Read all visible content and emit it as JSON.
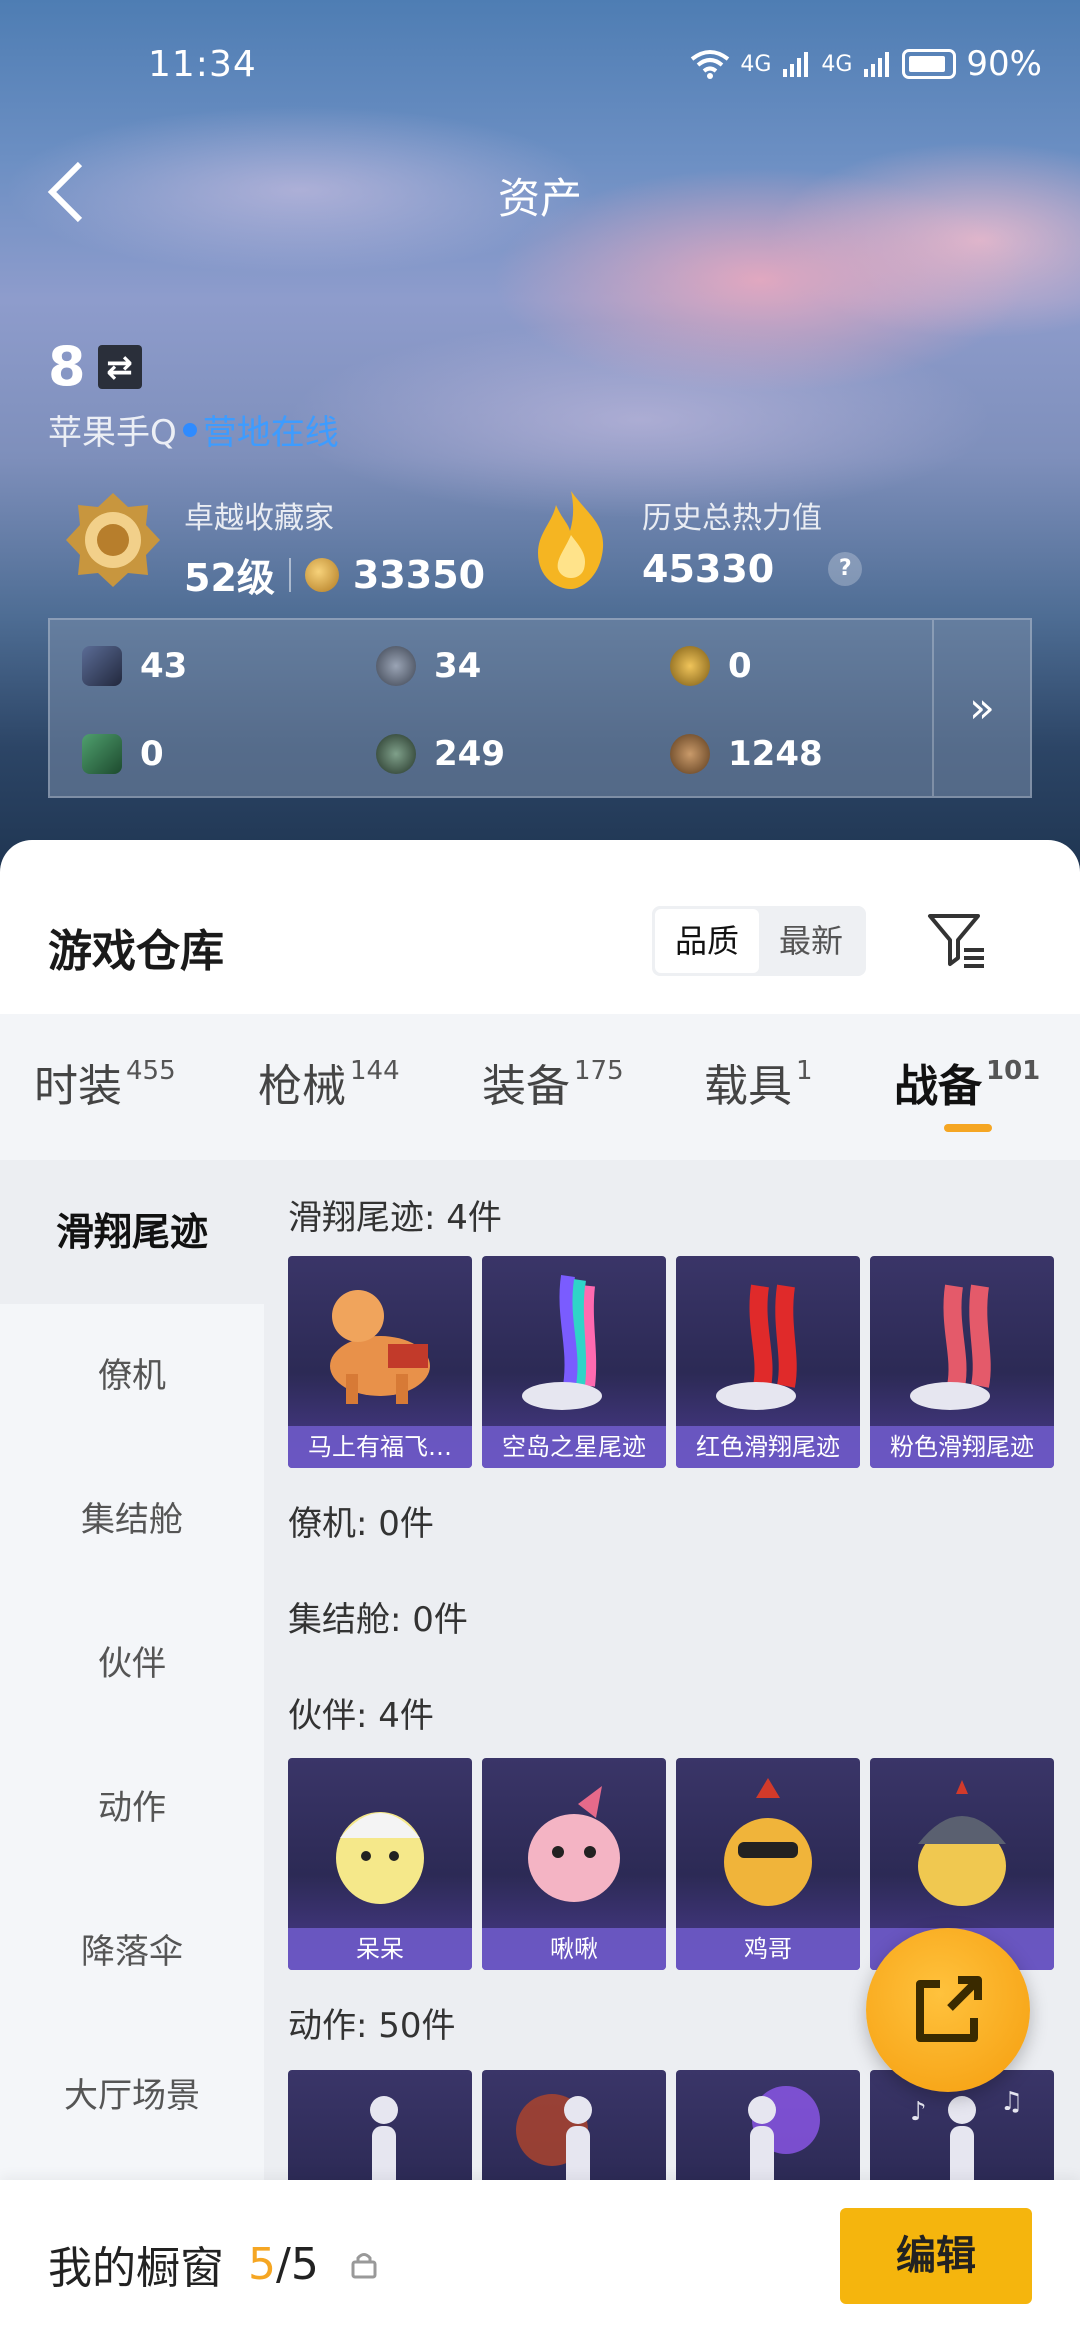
{
  "status_bar": {
    "time": "11:34",
    "network": "4G",
    "battery": "90%"
  },
  "header": {
    "title": "资产"
  },
  "user": {
    "level": "8",
    "platform": "苹果手Q",
    "status": "营地在线"
  },
  "collector": {
    "label": "卓越收藏家",
    "level": "52级",
    "points": "33350"
  },
  "heat": {
    "label": "历史总热力值",
    "value": "45330",
    "help": "?"
  },
  "currencies": [
    {
      "name": "card-icon",
      "value": "43"
    },
    {
      "name": "silver-coin-icon",
      "value": "34"
    },
    {
      "name": "gold-coin-icon",
      "value": "0"
    },
    {
      "name": "ticket-icon",
      "value": "0"
    },
    {
      "name": "green-gem-icon",
      "value": "249"
    },
    {
      "name": "bronze-coin-icon",
      "value": "1248"
    }
  ],
  "warehouse": {
    "title": "游戏仓库",
    "sort_options": [
      "品质",
      "最新"
    ],
    "sort_selected": "品质"
  },
  "tabs": [
    {
      "label": "时装",
      "count": "455"
    },
    {
      "label": "枪械",
      "count": "144"
    },
    {
      "label": "装备",
      "count": "175"
    },
    {
      "label": "载具",
      "count": "1"
    },
    {
      "label": "战备",
      "count": "101"
    }
  ],
  "sidebar": [
    "滑翔尾迹",
    "僚机",
    "集结舱",
    "伙伴",
    "动作",
    "降落伞",
    "大厅场景"
  ],
  "sections": {
    "trail": {
      "title": "滑翔尾迹: 4件",
      "items": [
        "马上有福飞…",
        "空岛之星尾迹",
        "红色滑翔尾迹",
        "粉色滑翔尾迹"
      ]
    },
    "wingman": {
      "title": "僚机: 0件"
    },
    "capsule": {
      "title": "集结舱: 0件"
    },
    "partner": {
      "title": "伙伴: 4件",
      "items": [
        "呆呆",
        "啾啾",
        "鸡哥",
        ""
      ]
    },
    "emote": {
      "title": "动作: 50件"
    }
  },
  "bottom": {
    "title": "我的橱窗",
    "count_current": "5",
    "count_total": "/5",
    "edit": "编辑"
  },
  "colors": {
    "accent": "#f5a623",
    "online": "#3d9cff",
    "card_bg": "#2c2a55",
    "card_label": "#6e5ac8"
  }
}
